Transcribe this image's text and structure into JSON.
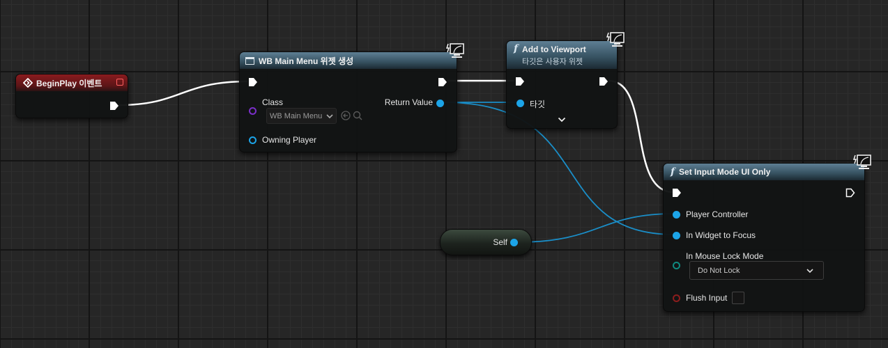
{
  "begin_play": {
    "title": "BeginPlay 이벤트"
  },
  "create_widget": {
    "title": "WB Main Menu 위젯 생성",
    "class_label": "Class",
    "class_value": "WB Main Menu",
    "return_label": "Return Value",
    "owning_player_label": "Owning Player"
  },
  "add_to_viewport": {
    "title": "Add to Viewport",
    "subtitle": "타깃은 사용자 위젯",
    "target_label": "타깃"
  },
  "set_input_mode": {
    "title": "Set Input Mode UI Only",
    "player_controller_label": "Player Controller",
    "widget_focus_label": "In Widget to Focus",
    "mouse_lock_label": "In Mouse Lock Mode",
    "mouse_lock_value": "Do Not Lock",
    "flush_input_label": "Flush Input"
  },
  "self_node": {
    "label": "Self"
  },
  "colors": {
    "exec_wire": "#ffffff",
    "object_pin": "#1ca4e8",
    "class_pin": "#7a2fc9",
    "enum_pin": "#0f8a80",
    "bool_pin": "#8c1d1d",
    "event_header": "#8a1b1e",
    "function_header": "#35505f"
  }
}
